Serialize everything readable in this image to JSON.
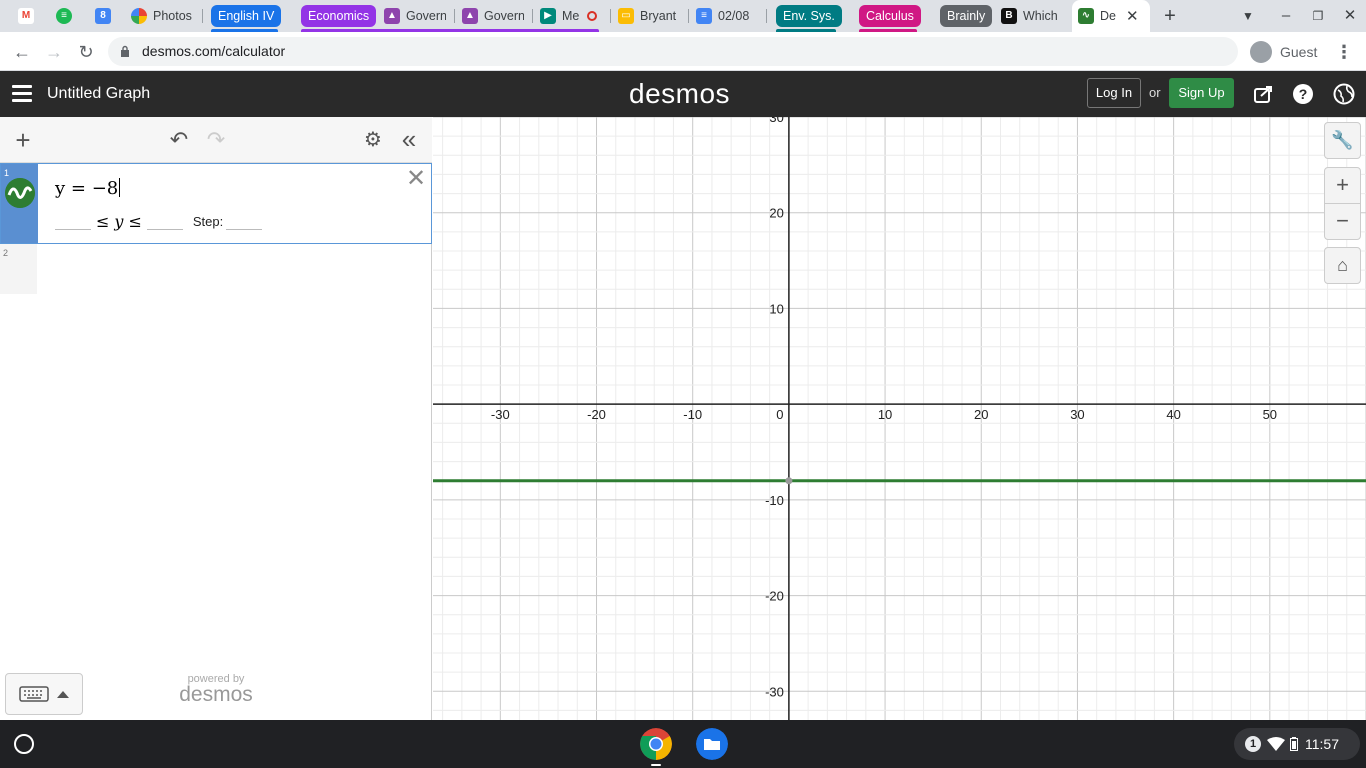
{
  "browser": {
    "tabs": [
      {
        "label": "",
        "icon": "gmail-icon"
      },
      {
        "label": "",
        "icon": "spotify-icon"
      },
      {
        "label": "",
        "icon": "calendar-icon"
      },
      {
        "label": "Photos",
        "icon": "photos-icon"
      },
      {
        "label": "Govern",
        "icon": "classroom-icon"
      },
      {
        "label": "Govern",
        "icon": "classroom-icon"
      },
      {
        "label": "Me",
        "icon": "meet-icon"
      },
      {
        "label": "Bryant",
        "icon": "slides-icon"
      },
      {
        "label": "02/08",
        "icon": "docs-icon"
      },
      {
        "label": "Which",
        "icon": "brainly-icon"
      },
      {
        "label": "De",
        "icon": "desmos-icon"
      }
    ],
    "groups": [
      {
        "label": "English IV",
        "color": "#1a73e8"
      },
      {
        "label": "Economics",
        "color": "#9334e6"
      },
      {
        "label": "Env. Sys.",
        "color": "#007b83"
      },
      {
        "label": "Calculus",
        "color": "#d01884"
      },
      {
        "label": "Brainly",
        "color": "#5f6368"
      }
    ],
    "url": "desmos.com/calculator",
    "profile_label": "Guest"
  },
  "desmos": {
    "graph_title": "Untitled Graph",
    "brand": "desmos",
    "login_label": "Log In",
    "or_label": "or",
    "signup_label": "Sign Up",
    "expressions": [
      {
        "index": "1",
        "latex": "y = −8",
        "color": "#2e7d32",
        "value": -8
      },
      {
        "index": "2",
        "latex": ""
      }
    ],
    "domain_var": "y",
    "step_label": "Step:",
    "powered_by": "powered by",
    "powered_brand": "desmos"
  },
  "chart_data": {
    "type": "line",
    "x_ticks": [
      "-30",
      "-20",
      "-10",
      "0",
      "10",
      "20",
      "30",
      "40",
      "50"
    ],
    "y_ticks": [
      "30",
      "20",
      "10",
      "-10",
      "-20",
      "-30"
    ],
    "xlim": [
      -37,
      60
    ],
    "ylim": [
      -33,
      30
    ],
    "grid": true,
    "series": [
      {
        "expression": "y = -8",
        "color": "#2e7d32",
        "y": -8
      }
    ]
  },
  "shelf": {
    "apps": [
      "chrome-icon",
      "files-icon"
    ],
    "notification_count": "1",
    "time": "11:57"
  }
}
